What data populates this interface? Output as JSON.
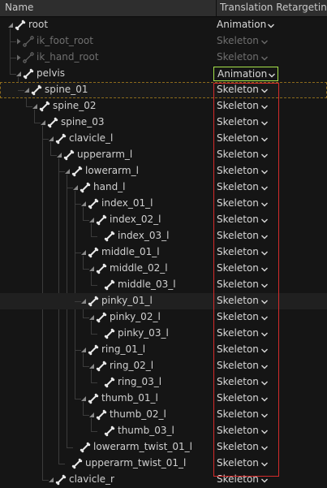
{
  "header": {
    "name_label": "Name",
    "translation_label": "Translation Retargeting"
  },
  "rows": [
    {
      "label": "root",
      "mode": "Animation",
      "depth": 0,
      "expanded": true,
      "dim": false
    },
    {
      "label": "ik_foot_root",
      "mode": "Skeleton",
      "depth": 1,
      "expanded": false,
      "dim": true
    },
    {
      "label": "ik_hand_root",
      "mode": "Skeleton",
      "depth": 1,
      "expanded": false,
      "dim": true
    },
    {
      "label": "pelvis",
      "mode": "Animation",
      "depth": 1,
      "expanded": true,
      "dim": false,
      "outlined": true
    },
    {
      "label": "spine_01",
      "mode": "Skeleton",
      "depth": 2,
      "expanded": true,
      "dim": false,
      "selected": true
    },
    {
      "label": "spine_02",
      "mode": "Skeleton",
      "depth": 3,
      "expanded": true,
      "dim": false
    },
    {
      "label": "spine_03",
      "mode": "Skeleton",
      "depth": 4,
      "expanded": true,
      "dim": false
    },
    {
      "label": "clavicle_l",
      "mode": "Skeleton",
      "depth": 5,
      "expanded": true,
      "dim": false
    },
    {
      "label": "upperarm_l",
      "mode": "Skeleton",
      "depth": 6,
      "expanded": true,
      "dim": false
    },
    {
      "label": "lowerarm_l",
      "mode": "Skeleton",
      "depth": 7,
      "expanded": true,
      "dim": false
    },
    {
      "label": "hand_l",
      "mode": "Skeleton",
      "depth": 8,
      "expanded": true,
      "dim": false
    },
    {
      "label": "index_01_l",
      "mode": "Skeleton",
      "depth": 9,
      "expanded": true,
      "dim": false
    },
    {
      "label": "index_02_l",
      "mode": "Skeleton",
      "depth": 10,
      "expanded": true,
      "dim": false
    },
    {
      "label": "index_03_l",
      "mode": "Skeleton",
      "depth": 11,
      "expanded": false,
      "leaf": true,
      "dim": false
    },
    {
      "label": "middle_01_l",
      "mode": "Skeleton",
      "depth": 9,
      "expanded": true,
      "dim": false
    },
    {
      "label": "middle_02_l",
      "mode": "Skeleton",
      "depth": 10,
      "expanded": true,
      "dim": false
    },
    {
      "label": "middle_03_l",
      "mode": "Skeleton",
      "depth": 11,
      "expanded": false,
      "leaf": true,
      "dim": false
    },
    {
      "label": "pinky_01_l",
      "mode": "Skeleton",
      "depth": 9,
      "expanded": true,
      "dim": false,
      "highlight": true
    },
    {
      "label": "pinky_02_l",
      "mode": "Skeleton",
      "depth": 10,
      "expanded": true,
      "dim": false
    },
    {
      "label": "pinky_03_l",
      "mode": "Skeleton",
      "depth": 11,
      "expanded": false,
      "leaf": true,
      "dim": false
    },
    {
      "label": "ring_01_l",
      "mode": "Skeleton",
      "depth": 9,
      "expanded": true,
      "dim": false
    },
    {
      "label": "ring_02_l",
      "mode": "Skeleton",
      "depth": 10,
      "expanded": true,
      "dim": false
    },
    {
      "label": "ring_03_l",
      "mode": "Skeleton",
      "depth": 11,
      "expanded": false,
      "leaf": true,
      "dim": false
    },
    {
      "label": "thumb_01_l",
      "mode": "Skeleton",
      "depth": 9,
      "expanded": true,
      "dim": false
    },
    {
      "label": "thumb_02_l",
      "mode": "Skeleton",
      "depth": 10,
      "expanded": true,
      "dim": false
    },
    {
      "label": "thumb_03_l",
      "mode": "Skeleton",
      "depth": 11,
      "expanded": false,
      "leaf": true,
      "dim": false
    },
    {
      "label": "lowerarm_twist_01_l",
      "mode": "Skeleton",
      "depth": 8,
      "expanded": false,
      "leaf": true,
      "dim": false
    },
    {
      "label": "upperarm_twist_01_l",
      "mode": "Skeleton",
      "depth": 7,
      "expanded": false,
      "leaf": true,
      "dim": false
    },
    {
      "label": "clavicle_r",
      "mode": "Skeleton",
      "depth": 5,
      "expanded": true,
      "dim": false
    }
  ],
  "colors": {
    "selection_outline": "#8c6a1c",
    "focused_dropdown": "#a6e34a",
    "annotation_box": "#d42b2b"
  },
  "icons": {
    "bone": "bone-icon",
    "expander": "expander-arrow-icon",
    "dropdown": "chevron-down-icon"
  }
}
